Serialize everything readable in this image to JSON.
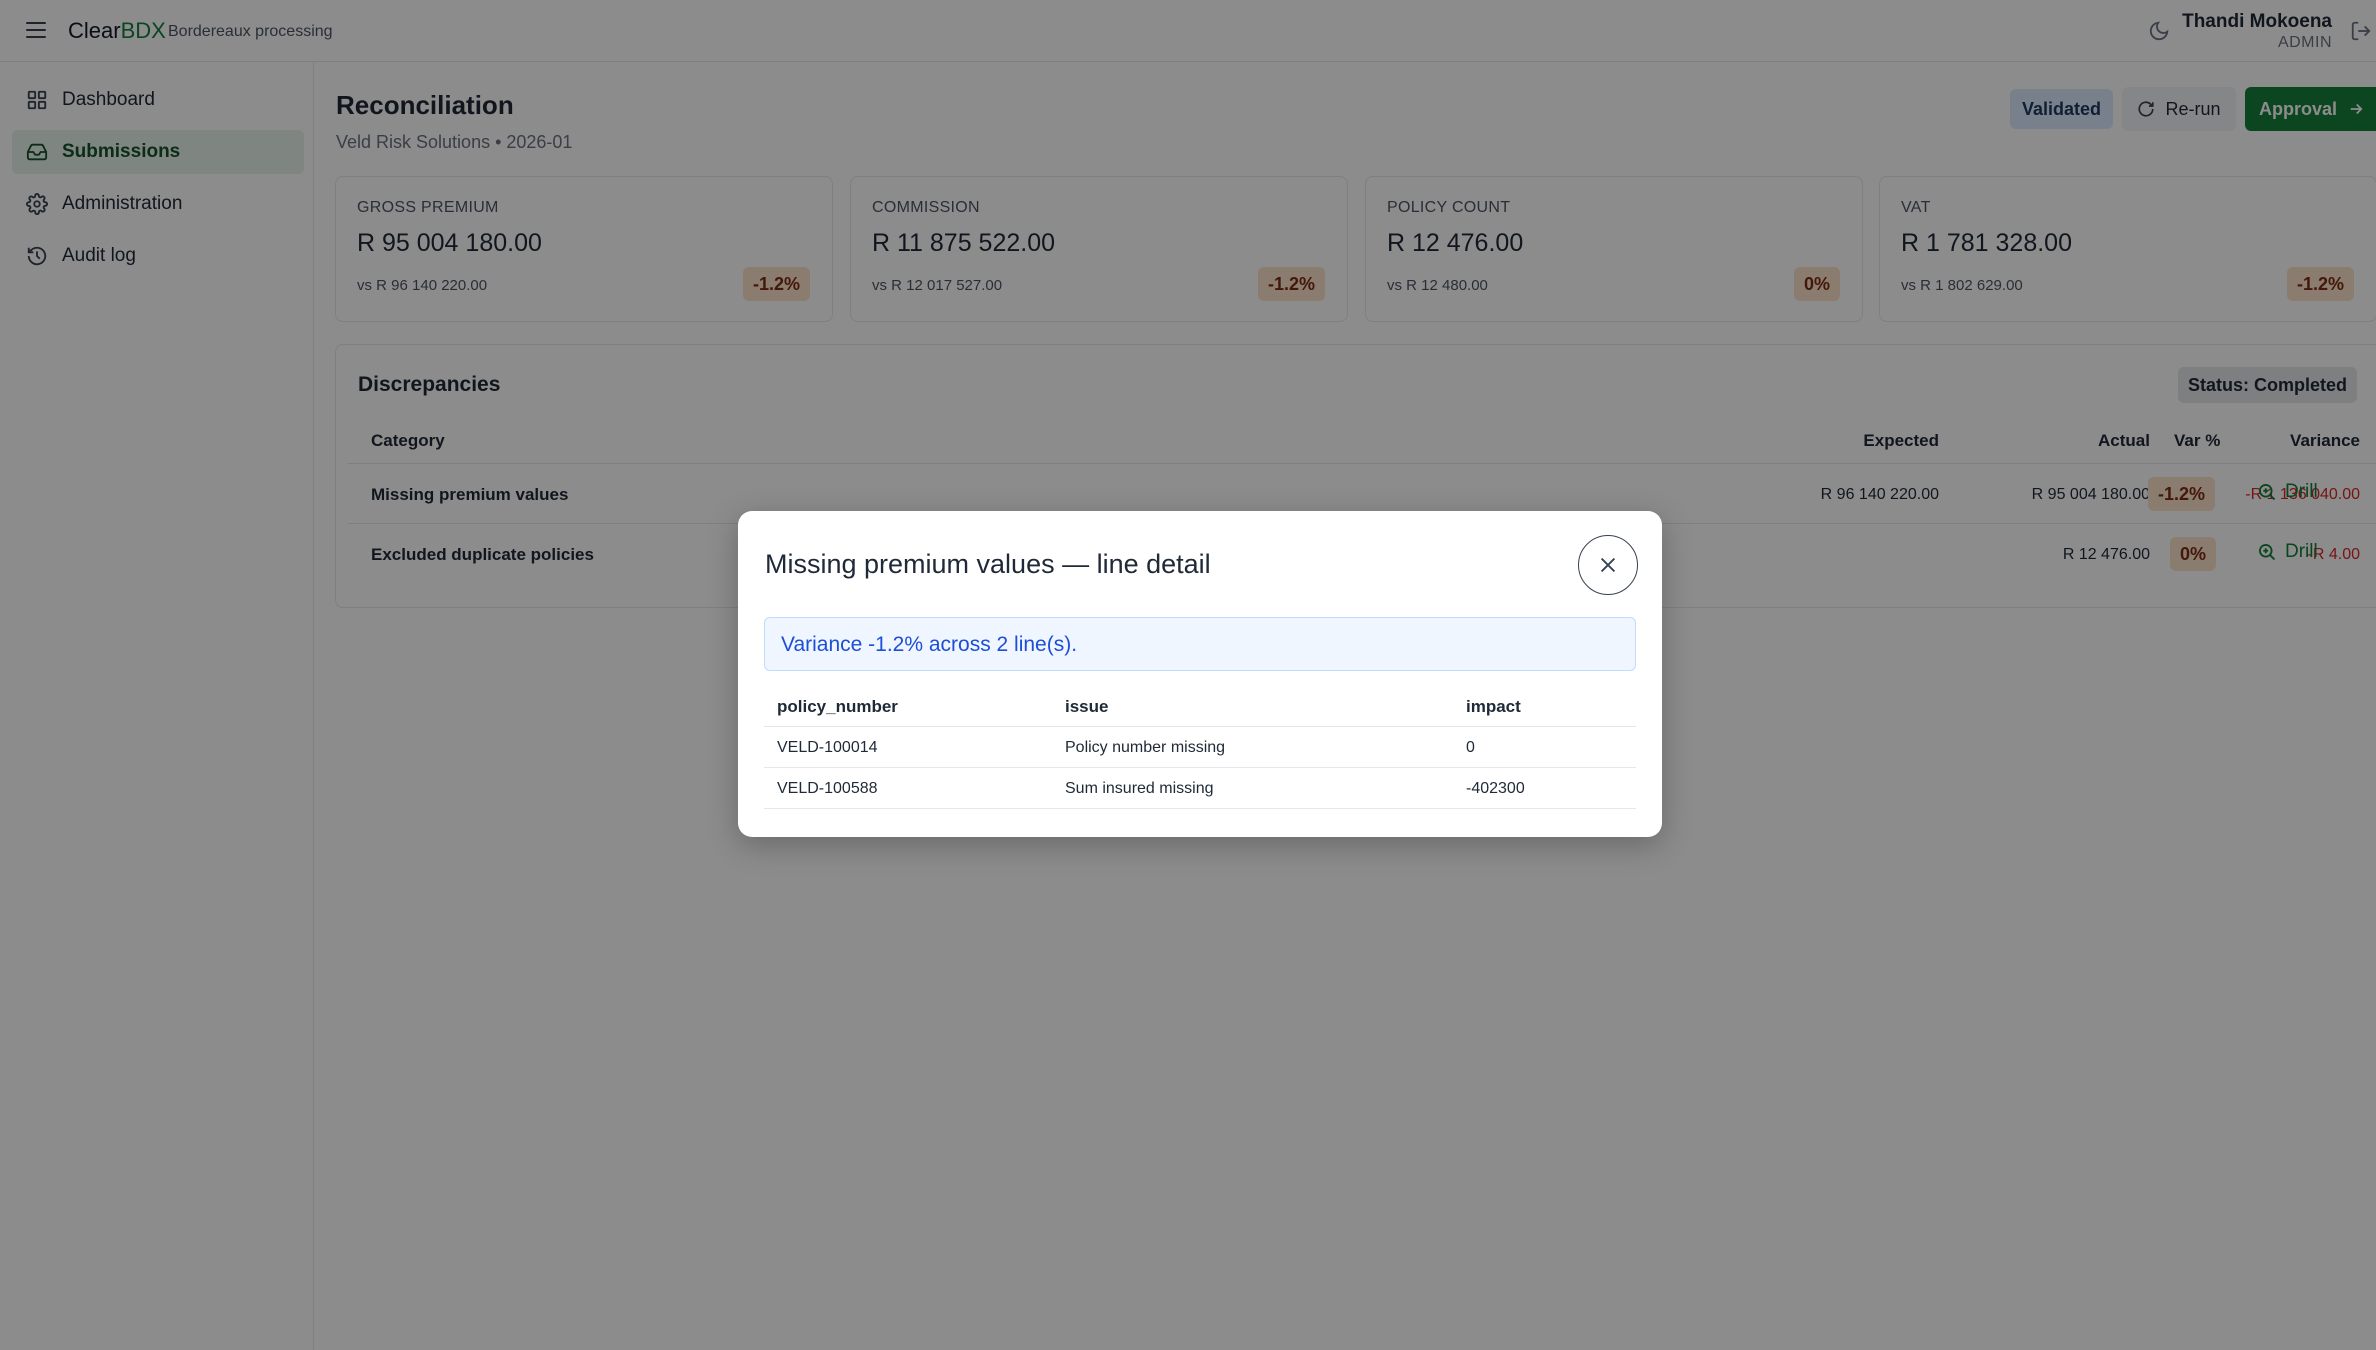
{
  "app": {
    "brand_part1": "Clear",
    "brand_part2": "BDX",
    "brand_sub": "Bordereaux processing",
    "brand_color": "#15803d"
  },
  "user": {
    "name": "Thandi Mokoena",
    "role": "ADMIN"
  },
  "sidebar": {
    "items": [
      {
        "label": "Dashboard",
        "icon": "grid-icon"
      },
      {
        "label": "Submissions",
        "icon": "inbox-icon",
        "active": true
      },
      {
        "label": "Administration",
        "icon": "gear-icon"
      },
      {
        "label": "Audit log",
        "icon": "history-icon"
      }
    ]
  },
  "page": {
    "title": "Reconciliation",
    "subtitle": "Veld Risk Solutions • 2026-01",
    "badge": "Validated",
    "rerun_label": "Re-run",
    "approval_label": "Approval"
  },
  "kpis": [
    {
      "label": "GROSS PREMIUM",
      "value": "R 95 004 180.00",
      "vs": "vs R 96 140 220.00",
      "delta": "-1.2%"
    },
    {
      "label": "COMMISSION",
      "value": "R 11 875 522.00",
      "vs": "vs R 12 017 527.00",
      "delta": "-1.2%"
    },
    {
      "label": "POLICY COUNT",
      "value": "R 12 476.00",
      "vs": "vs R 12 480.00",
      "delta": "0%"
    },
    {
      "label": "VAT",
      "value": "R 1 781 328.00",
      "vs": "vs R 1 802 629.00",
      "delta": "-1.2%"
    }
  ],
  "discrepancies": {
    "title": "Discrepancies",
    "status": "Status: Completed",
    "columns": [
      "Category",
      "Expected",
      "Actual",
      "Variance",
      "Var %"
    ],
    "drill_label": "Drill",
    "rows": [
      {
        "category": "Missing premium values",
        "expected": "R 96 140 220.00",
        "actual": "R 95 004 180.00",
        "variance": "-R 1 136 040.00",
        "var_pct": "-1.2%"
      },
      {
        "category": "Excluded duplicate policies",
        "expected": "",
        "actual": "R 12 476.00",
        "variance": "-R 4.00",
        "var_pct": "0%"
      }
    ]
  },
  "modal": {
    "title": "Missing premium values — line detail",
    "alert": "Variance -1.2% across 2 line(s).",
    "columns": [
      "policy_number",
      "issue",
      "impact"
    ],
    "rows": [
      {
        "policy_number": "VELD-100014",
        "issue": "Policy number missing",
        "impact": "0"
      },
      {
        "policy_number": "VELD-100588",
        "issue": "Sum insured missing",
        "impact": "-402300"
      }
    ]
  }
}
